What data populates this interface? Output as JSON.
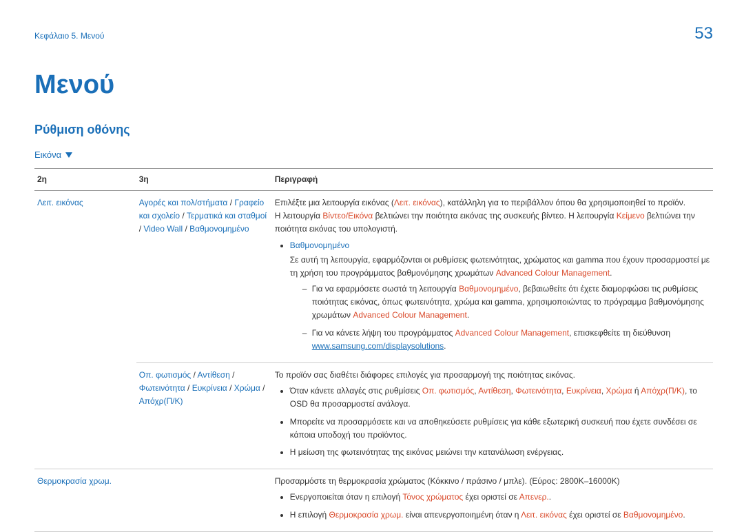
{
  "header": {
    "chapter": "Κεφάλαιο 5. Μενού",
    "page_number": "53"
  },
  "title": "Μενού",
  "section_heading": "Ρύθμιση οθόνης",
  "subsection": "Εικόνα",
  "table": {
    "headers": {
      "col2": "2η",
      "col3": "3η",
      "desc": "Περιγραφή"
    }
  },
  "row1": {
    "col1": "Λειτ. εικόνας",
    "col2": {
      "a": "Αγορές και πολ/στήματα",
      "s1": " / ",
      "b": "Γραφείο και σχολείο",
      "s2": " / ",
      "c": "Τερματικά και σταθμοί",
      "s3": " / ",
      "d": "Video Wall",
      "s4": " / ",
      "e": "Βαθμονομημένο"
    },
    "d_p1_a": "Επιλέξτε μια λειτουργία εικόνας (",
    "d_p1_b": "Λειτ. εικόνας",
    "d_p1_c": "), κατάλληλη για το περιβάλλον όπου θα χρησιμοποιηθεί το προϊόν.",
    "d_p2_a": "Η λειτουργία ",
    "d_p2_b": "Βίντεο/Εικόνα",
    "d_p2_c": " βελτιώνει την ποιότητα εικόνας της συσκευής βίντεο. Η λειτουργία ",
    "d_p2_d": "Κείμενο",
    "d_p2_e": " βελτιώνει την ποιότητα εικόνας του υπολογιστή.",
    "cal_label": "Βαθμονομημένο",
    "cal_text_a": "Σε αυτή τη λειτουργία, εφαρμόζονται οι ρυθμίσεις φωτεινότητας, χρώματος και gamma που έχουν προσαρμοστεί με τη χρήση του προγράμματος βαθμονόμησης χρωμάτων ",
    "cal_text_b": "Advanced Colour Management",
    "cal_text_c": ".",
    "cal_s1_a": "Για να εφαρμόσετε σωστά τη λειτουργία ",
    "cal_s1_b": "Βαθμονομημένο",
    "cal_s1_c": ", βεβαιωθείτε ότι έχετε διαμορφώσει τις ρυθμίσεις ποιότητας εικόνας, όπως φωτεινότητα, χρώμα και gamma, χρησιμοποιώντας το πρόγραμμα βαθμονόμησης χρωμάτων ",
    "cal_s1_d": "Advanced Colour Management",
    "cal_s1_e": ".",
    "cal_s2_a": "Για να κάνετε λήψη του προγράμματος ",
    "cal_s2_b": "Advanced Colour Management",
    "cal_s2_c": ", επισκεφθείτε τη διεύθυνση ",
    "cal_s2_d": "www.samsung.com/displaysolutions",
    "cal_s2_e": "."
  },
  "row2": {
    "col2": {
      "a": "Οπ. φωτισμός",
      "s1": " / ",
      "b": "Αντίθεση",
      "s2": " / ",
      "c": "Φωτεινότητα",
      "s3": " / ",
      "d": "Ευκρίνεια",
      "s4": " / ",
      "e": "Χρώμα",
      "s5": " / ",
      "f": "Απόχρ(Π/Κ)"
    },
    "p1": "Το προϊόν σας διαθέτει διάφορες επιλογές για προσαρμογή της ποιότητας εικόνας.",
    "b1_a": "Όταν κάνετε αλλαγές στις ρυθμίσεις ",
    "b1_b": "Οπ. φωτισμός",
    "b1_s1": ", ",
    "b1_c": "Αντίθεση",
    "b1_s2": ", ",
    "b1_d": "Φωτεινότητα",
    "b1_s3": ", ",
    "b1_e": "Ευκρίνεια",
    "b1_s4": ", ",
    "b1_f": "Χρώμα",
    "b1_s5": " ή ",
    "b1_g": "Απόχρ(Π/Κ)",
    "b1_h": ", το OSD θα προσαρμοστεί ανάλογα.",
    "b2": "Μπορείτε να προσαρμόσετε και να αποθηκεύσετε ρυθμίσεις για κάθε εξωτερική συσκευή που έχετε συνδέσει σε κάποια υποδοχή του προϊόντος.",
    "b3": "Η μείωση της φωτεινότητας της εικόνας μειώνει την κατανάλωση ενέργειας."
  },
  "row3": {
    "col1": "Θερμοκρασία χρωμ.",
    "p1": "Προσαρμόστε τη θερμοκρασία χρώματος (Κόκκινο / πράσινο / μπλε). (Εύρος: 2800K–16000K)",
    "b1_a": "Ενεργοποιείται όταν η επιλογή ",
    "b1_b": "Τόνος χρώματος",
    "b1_c": " έχει οριστεί σε ",
    "b1_d": "Απενερ.",
    "b1_e": ".",
    "b2_a": "Η επιλογή ",
    "b2_b": "Θερμοκρασία χρωμ.",
    "b2_c": " είναι απενεργοποιημένη όταν η ",
    "b2_d": "Λειτ. εικόνας",
    "b2_e": " έχει οριστεί σε ",
    "b2_f": "Βαθμονομημένο",
    "b2_g": "."
  }
}
